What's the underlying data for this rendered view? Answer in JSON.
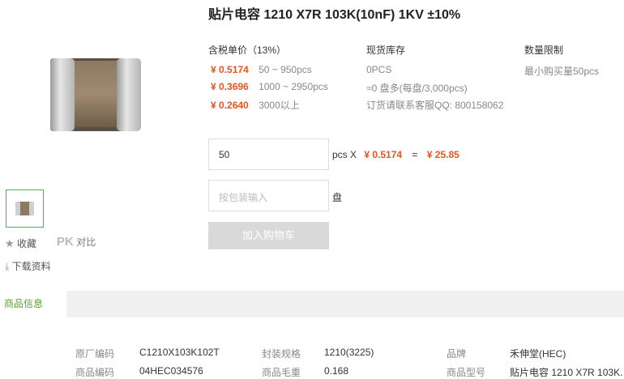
{
  "product": {
    "title": "贴片电容 1210 X7R 103K(10nF) 1KV ±10%"
  },
  "pricing": {
    "header": "含税单价（13%）",
    "tiers": [
      {
        "price": "¥ 0.5174",
        "range": "50 ~ 950pcs"
      },
      {
        "price": "¥ 0.3696",
        "range": "1000 ~ 2950pcs"
      },
      {
        "price": "¥ 0.2640",
        "range": "3000以上"
      }
    ]
  },
  "stock": {
    "header": "现货库存",
    "lines": [
      "0PCS",
      "≈0 盘多(每盘/3,000pcs)",
      "订货请联系客服QQ: 800158062"
    ]
  },
  "limit": {
    "header": "数量限制",
    "text": "最小购买量50pcs"
  },
  "order": {
    "qty_value": "50",
    "unit": "pcs X",
    "unit_price": "¥ 0.5174",
    "equals": "=",
    "total": "¥ 25.85",
    "reel_placeholder": "按包装输入",
    "reel_unit": "盘",
    "add_to_cart": "加入购物车"
  },
  "actions": {
    "favorite": "收藏",
    "pk": "PK",
    "compare": "对比",
    "download": "下载资料"
  },
  "tabs": {
    "active": "商品信息"
  },
  "specs": [
    {
      "label": "原厂编码",
      "value": "C1210X103K102T"
    },
    {
      "label": "封装规格",
      "value": "1210(3225)"
    },
    {
      "label": "品牌",
      "value": "禾伸堂(HEC)"
    },
    {
      "label": "商品编码",
      "value": "04HEC034576"
    },
    {
      "label": "商品毛重",
      "value": "0.168"
    },
    {
      "label": "商品型号",
      "value": "贴片电容 1210 X7R 103K."
    }
  ],
  "colors": {
    "price": "#e8541e",
    "accent_green": "#5aa02c",
    "button_disabled": "#d9d9d9"
  }
}
